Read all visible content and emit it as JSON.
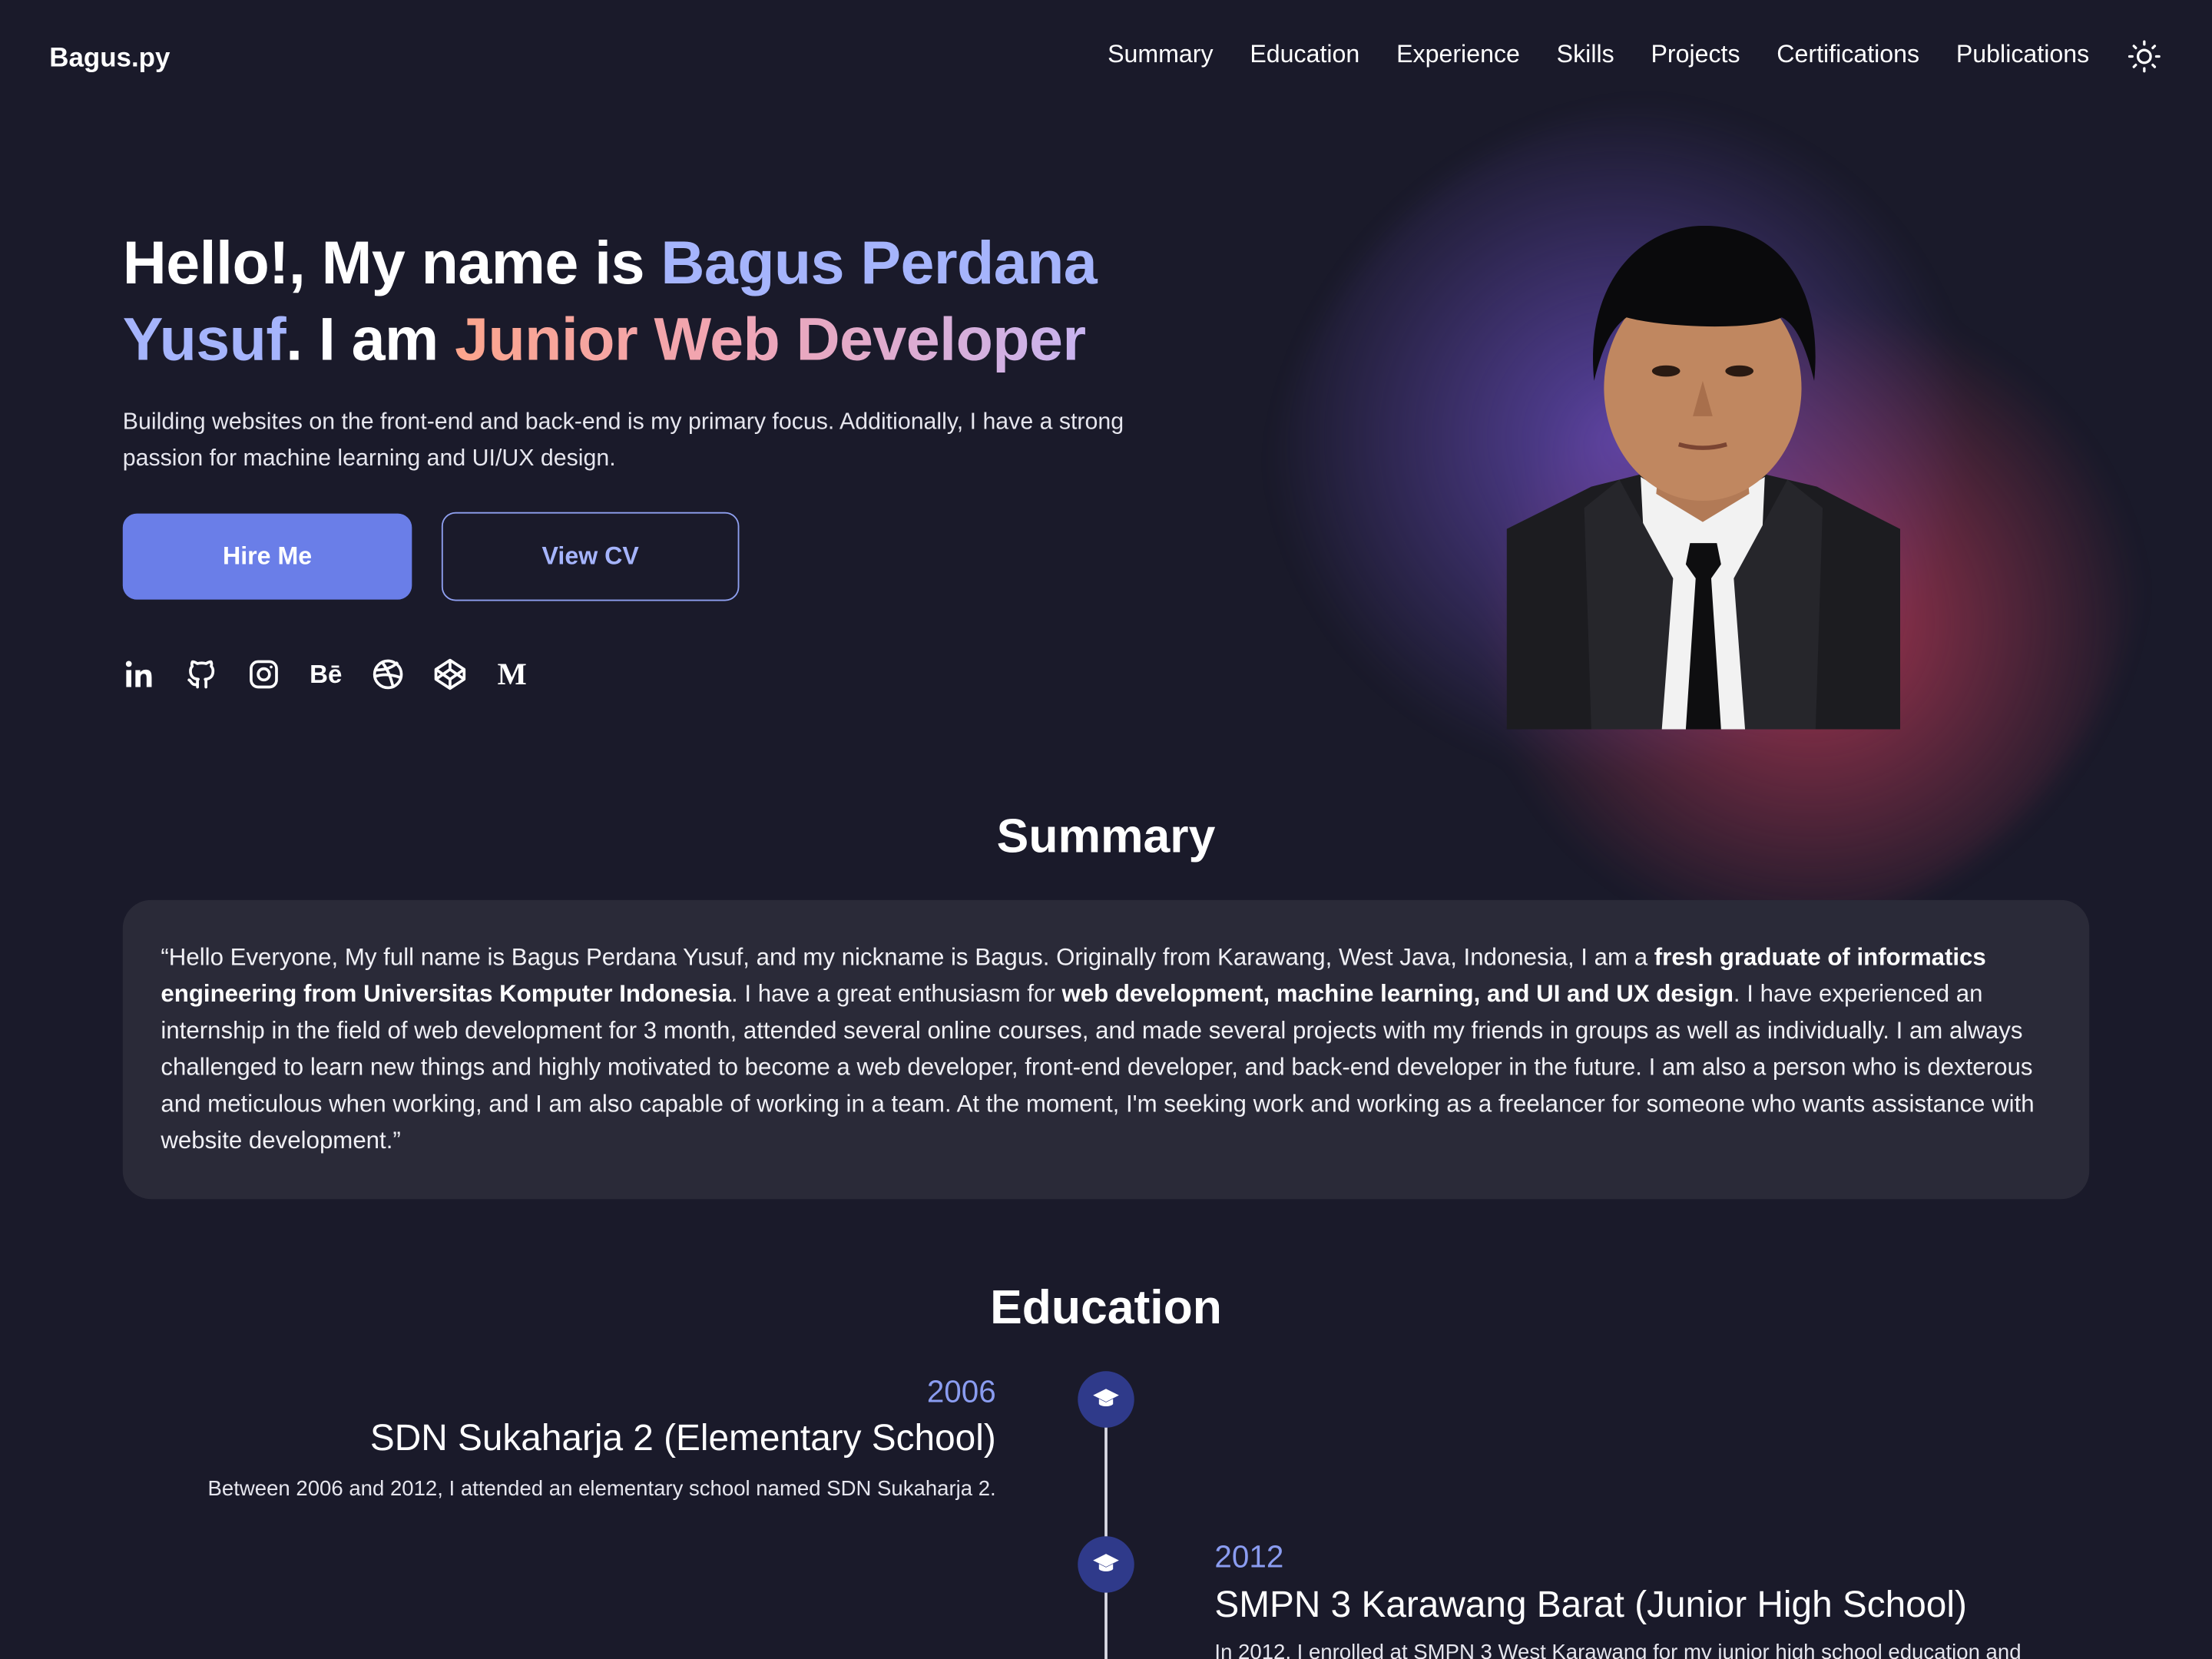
{
  "brand": "Bagus.py",
  "nav": {
    "items": [
      "Summary",
      "Education",
      "Experience",
      "Skills",
      "Projects",
      "Certifications",
      "Publications"
    ],
    "theme_icon": "sun-icon"
  },
  "hero": {
    "title_part1": "Hello!, My name is ",
    "name": "Bagus Perdana Yusuf",
    "title_part2": ". I am ",
    "role": "Junior Web Developer",
    "description": "Building websites on the front-end and back-end is my primary focus. Additionally, I have a strong passion for machine learning and UI/UX design.",
    "hire_label": "Hire Me",
    "cv_label": "View CV",
    "socials": [
      "linkedin-icon",
      "github-icon",
      "instagram-icon",
      "behance-icon",
      "dribbble-icon",
      "codepen-icon",
      "medium-icon"
    ],
    "behance_text": "Bē",
    "medium_text": "M"
  },
  "summary": {
    "title": "Summary",
    "p1": "“Hello Everyone, My full name is Bagus Perdana Yusuf, and my nickname is Bagus. Originally from Karawang, West Java, Indonesia, I am a ",
    "b1": "fresh graduate of informatics engineering from Universitas Komputer Indonesia",
    "p2": ". I have a great enthusiasm for ",
    "b2": "web development, machine learning, and UI and UX design",
    "p3": ". I have experienced an internship in the field of web development for 3 month, attended several online courses, and made several projects with my friends in groups as well as individually. I am always challenged to learn new things and highly motivated to become a web developer, front-end developer, and back-end developer in the future. I am also a person who is dexterous and meticulous when working, and I am also capable of working in a team. At the moment, I'm seeking work and working as a freelancer for someone who wants assistance with website development.”"
  },
  "education": {
    "title": "Education",
    "items": [
      {
        "year": "2006",
        "school": "SDN Sukaharja 2 (Elementary School)",
        "description": "Between 2006 and 2012, I attended an elementary school named SDN Sukaharja 2."
      },
      {
        "year": "2012",
        "school": "SMPN 3 Karawang Barat (Junior High School)",
        "description": "In 2012, I enrolled at SMPN 3 West Karawang for my junior high school education and"
      }
    ]
  },
  "colors": {
    "background": "#1a1a2a",
    "accent": "#6a7ee8",
    "accent_light": "#a5b4fc",
    "card": "#2a2a38"
  }
}
